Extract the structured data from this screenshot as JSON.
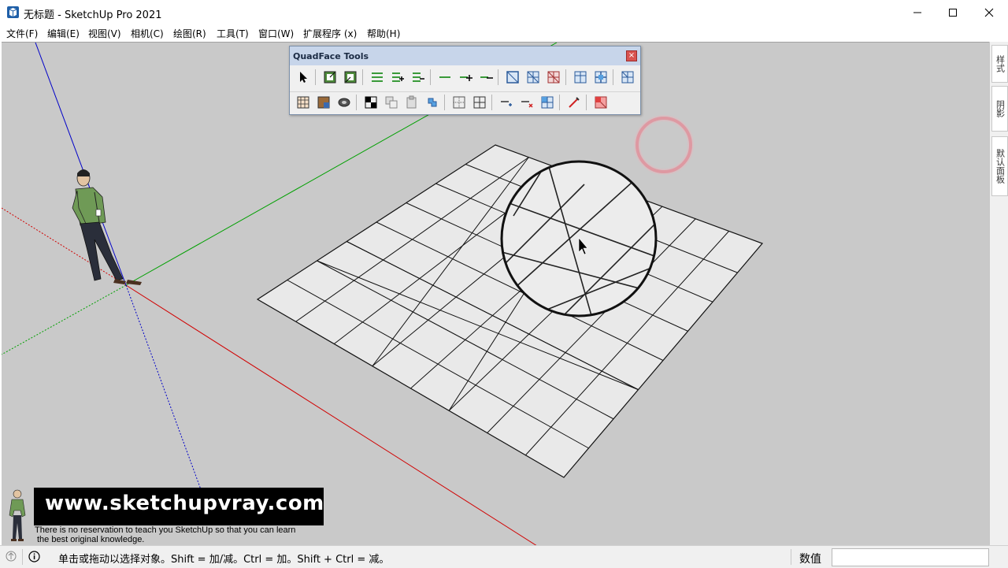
{
  "window": {
    "title": "无标题 - SketchUp Pro 2021",
    "minimize_icon": "minimize-icon",
    "maximize_icon": "maximize-icon",
    "close_icon": "close-icon"
  },
  "menu": {
    "items": [
      {
        "label": "文件(F)"
      },
      {
        "label": "编辑(E)"
      },
      {
        "label": "视图(V)"
      },
      {
        "label": "相机(C)"
      },
      {
        "label": "绘图(R)"
      },
      {
        "label": "工具(T)"
      },
      {
        "label": "窗口(W)"
      },
      {
        "label": "扩展程序 (x)"
      },
      {
        "label": "帮助(H)"
      }
    ]
  },
  "toolbar": {
    "title": "QuadFace Tools",
    "close_label": "×"
  },
  "right_panel": {
    "tabs": [
      {
        "label": "样式"
      },
      {
        "label": "阴影"
      },
      {
        "label": "默认面板"
      }
    ]
  },
  "watermark": {
    "url": "www.sketchupvray.com",
    "line1": "There is no reservation to teach you SketchUp so that you can learn",
    "line2": "the best original knowledge."
  },
  "status": {
    "hint": "单击或拖动以选择对象。Shift = 加/减。Ctrl = 加。Shift + Ctrl = 减。",
    "measure_label": "数值",
    "measure_value": ""
  },
  "colors": {
    "viewport_bg": "#c9c9c9",
    "axis_red": "#d10000",
    "axis_green": "#00a000",
    "axis_blue": "#0000c8",
    "toolbar_title_bg": "#c7d5ea",
    "click_ring": "#e05060"
  }
}
